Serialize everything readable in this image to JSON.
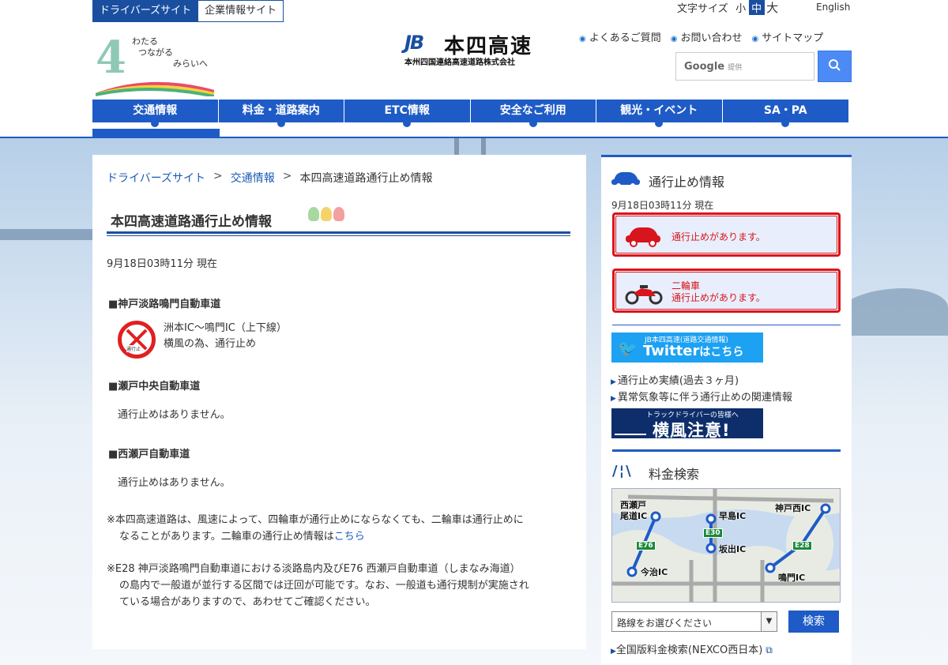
{
  "header": {
    "site_tabs": [
      "ドライバーズサイト",
      "企業情報サイト"
    ],
    "slogan": [
      "わたる",
      "つながる",
      "みらいへ"
    ],
    "brand_mark": "JB",
    "brand_name": "本四高速",
    "brand_sub": "本州四国連絡高速道路株式会社",
    "font_size_label": "文字サイズ",
    "font_sizes": [
      "小",
      "中",
      "大"
    ],
    "english": "English",
    "util_links": [
      "よくあるご質問",
      "お問い合わせ",
      "サイトマップ"
    ],
    "search_placeholder_brand": "Google",
    "search_placeholder_sub": "提供"
  },
  "nav": [
    "交通情報",
    "料金・道路案内",
    "ETC情報",
    "安全なご利用",
    "観光・イベント",
    "SA・PA"
  ],
  "breadcrumb": [
    "ドライバーズサイト",
    ">",
    "交通情報",
    ">",
    "本四高速道路通行止め情報"
  ],
  "main": {
    "title": "本四高速道路通行止め情報",
    "as_of": "9月18日03時11分 現在",
    "sections": [
      {
        "name": "■神戸淡路鳴門自動車道",
        "lines": [
          "洲本IC～鳴門IC（上下線）",
          "横風の為、通行止め"
        ],
        "icon_label": "通行止"
      },
      {
        "name": "■瀬戸中央自動車道",
        "lines": [
          "通行止めはありません。"
        ]
      },
      {
        "name": "■西瀬戸自動車道",
        "lines": [
          "通行止めはありません。"
        ]
      }
    ],
    "note1_a": "※本四高速道路は、風速によって、四輪車が通行止めにならなくても、二輪車は通行止めに",
    "note1_b": "なることがあります。二輪車の通行止め情報は",
    "note1_link": "こちら",
    "note2_a": "※E28 神戸淡路鳴門自動車道における淡路島内及びE76 西瀬戸自動車道（しまなみ海道）",
    "note2_b": "の島内で一般道が並行する区間では迂回が可能です。なお、一般道も通行規制が実施され",
    "note2_c": "ている場合がありますので、あわせてご確認ください。"
  },
  "sidebar": {
    "closure_heading": "通行止め情報",
    "as_of": "9月18日03時11分 現在",
    "alert_car": "通行止めがあります。",
    "alert_bike_1": "二輪車",
    "alert_bike_2": "通行止めがあります。",
    "twitter_small": "JB本四高速(道路交通情報)",
    "twitter_big": "Twitter",
    "twitter_big_suffix": "はこちら",
    "link_history": "通行止め実績(過去３ヶ月)",
    "link_weather": "異常気象等に伴う通行止めの関連情報",
    "yokokaze_small": "トラックドライバーの皆様へ",
    "yokokaze_big": "横風注意!",
    "toll_heading": "料金検索",
    "map_labels": {
      "nishiseto": "西瀬戸",
      "onomichi": "尾道IC",
      "hayashima": "早島IC",
      "kobenishi": "神戸西IC",
      "sakaide": "坂出IC",
      "imabari": "今治IC",
      "naruto": "鳴門IC",
      "e76": "E76",
      "e30": "E30",
      "e28": "E28"
    },
    "route_select": "路線をお選びください",
    "search_button": "検索",
    "nexco_link": "全国版料金検索(NEXCO西日本)"
  },
  "colors": {
    "brand_blue": "#1e5bc6",
    "alert_red": "#d8141c",
    "twitter_blue": "#1da1f2"
  }
}
